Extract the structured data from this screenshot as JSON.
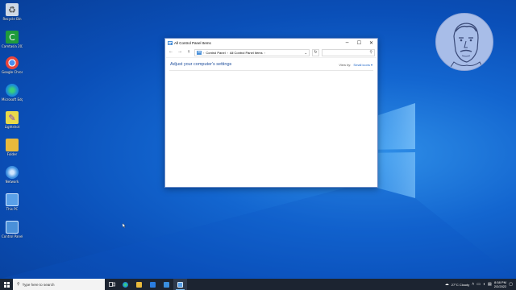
{
  "desktop_icons": [
    {
      "label": "Recycle Bin",
      "color": "#cfd8e6",
      "glyph": "🗑"
    },
    {
      "label": "Camtasia 2020",
      "color": "#1e9b3c",
      "glyph": "C"
    },
    {
      "label": "Google Chrome",
      "color": "#e8453c",
      "glyph": "●"
    },
    {
      "label": "Microsoft Edge",
      "color": "#1b8bd8",
      "glyph": "e"
    },
    {
      "label": "Lightshot",
      "color": "#8b6bd6",
      "glyph": "✎"
    },
    {
      "label": "Folder",
      "color": "#e8b93c",
      "glyph": "▭"
    },
    {
      "label": "Network",
      "color": "#3d8fe0",
      "glyph": "◍"
    },
    {
      "label": "This PC",
      "color": "#5aa0e8",
      "glyph": "▭"
    },
    {
      "label": "Control Panel",
      "color": "#4a90d9",
      "glyph": "▤"
    }
  ],
  "window": {
    "title": "All Control Panel Items",
    "minimize": "─",
    "maximize": "☐",
    "close": "✕",
    "back": "←",
    "forward": "→",
    "up": "↑",
    "breadcrumb": [
      "Control Panel",
      "All Control Panel Items"
    ],
    "crumb_sep": "›",
    "dropdown": "⌄",
    "refresh": "↻",
    "search_icon": "⚲",
    "heading": "Adjust your computer's settings",
    "view_by_label": "View by:",
    "view_by_value": "Small icons ▾"
  },
  "taskbar": {
    "search_placeholder": "Type here to search",
    "apps": [
      {
        "name": "task-view",
        "color": "#ffffff"
      },
      {
        "name": "edge",
        "color": "#1b8bd8"
      },
      {
        "name": "file-explorer",
        "color": "#e8b93c"
      },
      {
        "name": "store",
        "color": "#2a7de0"
      },
      {
        "name": "mail",
        "color": "#3a8fdf"
      },
      {
        "name": "control-panel",
        "color": "#5aa0e8",
        "active": true
      }
    ],
    "weather": "27°C  Cloudy",
    "time": "8:58 PM",
    "date": "2/2/2022"
  },
  "colors": {
    "accent": "#1b63c6",
    "taskbar": "#1c2431"
  }
}
